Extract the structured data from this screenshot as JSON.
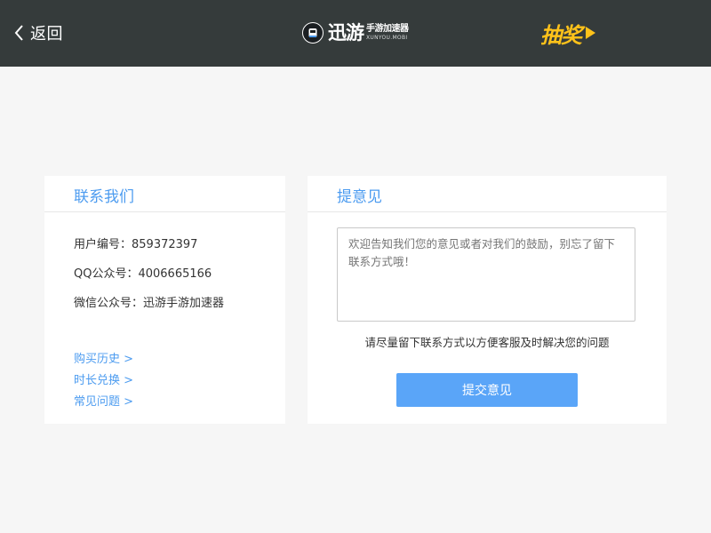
{
  "header": {
    "back_label": "返回",
    "logo": {
      "brand": "迅游",
      "subtitle_cn": "手游加速器",
      "subtitle_en": "XUNYOU.MOBI"
    },
    "lottery_label": "抽奖",
    "colors": {
      "bar": "#353b3b",
      "lottery": "#ffc21a"
    }
  },
  "contact_card": {
    "title": "联系我们",
    "user_id": "用户编号：859372397",
    "qq": "QQ公众号：4006665166",
    "wechat": "微信公众号：迅游手游加速器",
    "links": [
      "购买历史 >",
      "时长兑换 >",
      "常见问题 >"
    ]
  },
  "feedback_card": {
    "title": "提意见",
    "textarea_placeholder": "欢迎告知我们您的意见或者对我们的鼓励，别忘了留下联系方式哦！",
    "hint": "请尽量留下联系方式以方便客服及时解决您的问题",
    "submit_label": "提交意见"
  },
  "colors": {
    "accent": "#4d9cf0",
    "button": "#5aa5f8",
    "background": "#f6f6f6"
  }
}
